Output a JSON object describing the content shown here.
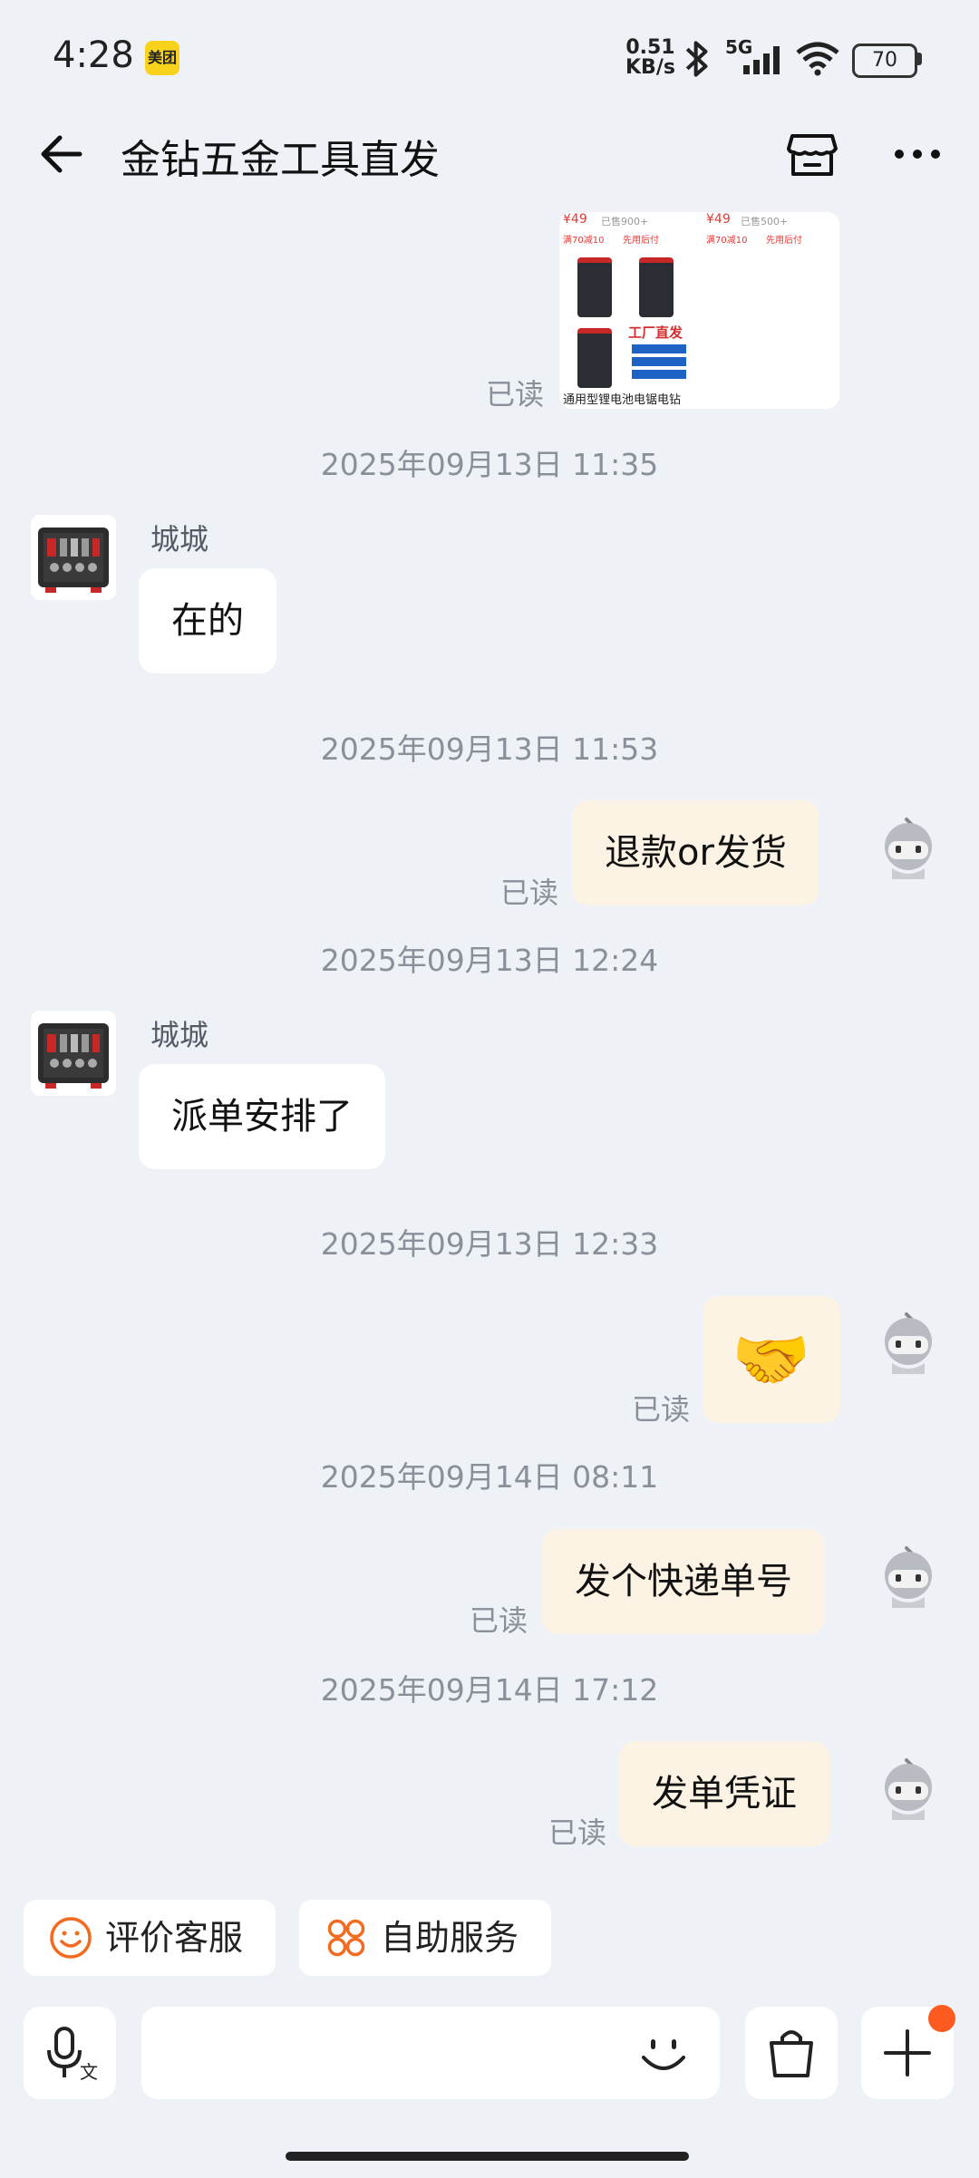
{
  "status_bar": {
    "time": "4:28",
    "app_badge": "美团",
    "net_speed_value": "0.51",
    "net_speed_unit": "KB/s",
    "network": "5G",
    "battery": "70"
  },
  "header": {
    "title": "金钻五金工具直发"
  },
  "product_card": {
    "left_price": "¥49",
    "left_sold": "已售900+",
    "right_price": "¥49",
    "right_sold": "已售500+",
    "tag1": "满70减10",
    "tag2": "先用后付",
    "banner": "工厂直发",
    "caption": "通用型锂电池电锯电钻"
  },
  "messages": [
    {
      "type": "read",
      "text": "已读"
    },
    {
      "type": "timestamp",
      "text": "2025年09月13日 11:35"
    },
    {
      "type": "incoming",
      "sender": "城城",
      "text": "在的"
    },
    {
      "type": "timestamp",
      "text": "2025年09月13日 11:53"
    },
    {
      "type": "outgoing",
      "read": "已读",
      "text": "退款or发货"
    },
    {
      "type": "timestamp",
      "text": "2025年09月13日 12:24"
    },
    {
      "type": "incoming",
      "sender": "城城",
      "text": "派单安排了"
    },
    {
      "type": "timestamp",
      "text": "2025年09月13日 12:33"
    },
    {
      "type": "outgoing",
      "read": "已读",
      "text": "🤝"
    },
    {
      "type": "timestamp",
      "text": "2025年09月14日 08:11"
    },
    {
      "type": "outgoing",
      "read": "已读",
      "text": "发个快递单号"
    },
    {
      "type": "timestamp",
      "text": "2025年09月14日 17:12"
    },
    {
      "type": "outgoing",
      "read": "已读",
      "text": "发单凭证"
    }
  ],
  "quick_actions": {
    "rate": "评价客服",
    "self_service": "自助服务"
  },
  "input_bar": {
    "voice_icon_label": "文"
  },
  "colors": {
    "background": "#eef1f6",
    "outgoing_bubble": "#fdf3e4",
    "accent": "#f26b21",
    "badge_dot": "#ff5a1f"
  }
}
